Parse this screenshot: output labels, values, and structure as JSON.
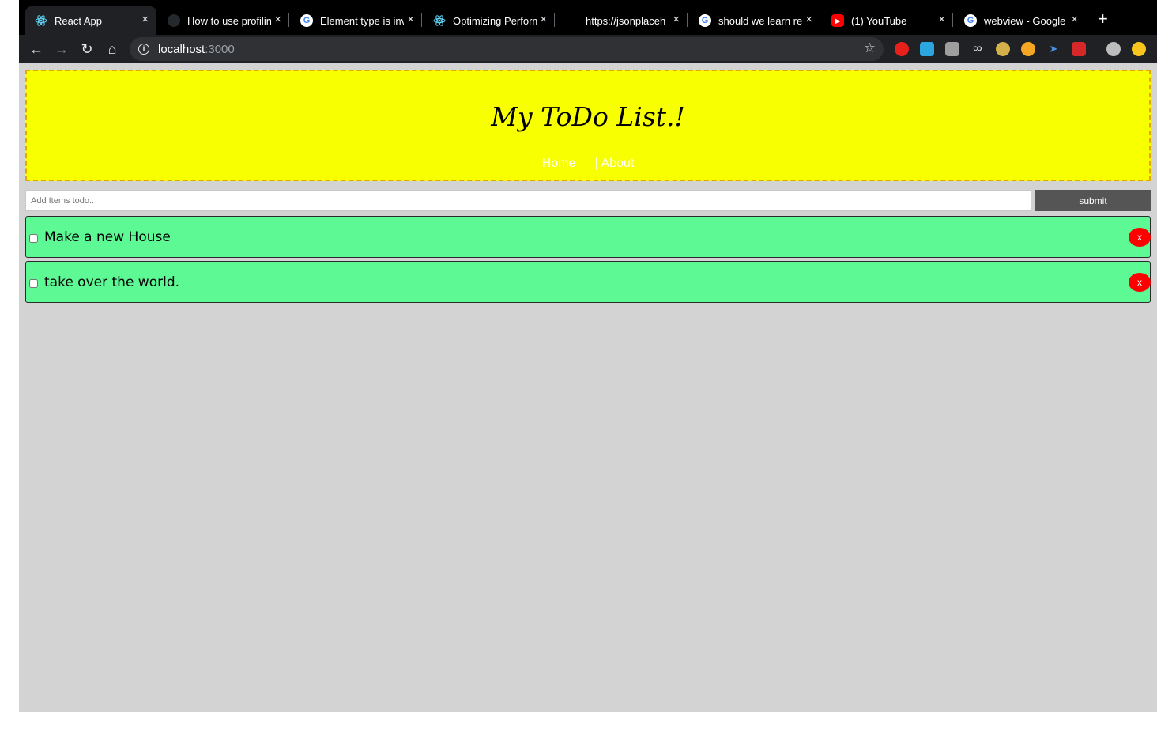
{
  "browser": {
    "tabs": [
      {
        "title": "React App",
        "favicon": "react-icon",
        "active": true
      },
      {
        "title": "How to use profiling",
        "favicon": "github-icon"
      },
      {
        "title": "Element type is inv",
        "favicon": "google-icon"
      },
      {
        "title": "Optimizing Perform",
        "favicon": "react-icon"
      },
      {
        "title": "https://jsonplaceh",
        "favicon": "blank-icon"
      },
      {
        "title": "should we learn re",
        "favicon": "google-icon"
      },
      {
        "title": "(1) YouTube",
        "favicon": "youtube-icon"
      },
      {
        "title": "webview - Google",
        "favicon": "google-icon"
      }
    ],
    "close_glyph": "×",
    "new_tab_glyph": "+",
    "address": {
      "host": "localhost",
      "port": ":3000"
    }
  },
  "app": {
    "title": "My ToDo List.!",
    "nav": {
      "home": "Home",
      "about": "| About"
    },
    "input_placeholder": "Add Items todo..",
    "submit_label": "submit",
    "todos": [
      {
        "text": "Make a new House",
        "done": false
      },
      {
        "text": "take over the world.",
        "done": false
      }
    ],
    "delete_label": "x",
    "colors": {
      "header_bg": "#f8ff00",
      "todo_bg": "#5cf994",
      "delete_bg": "#ff0000",
      "page_bg": "#d3d3d3"
    }
  }
}
